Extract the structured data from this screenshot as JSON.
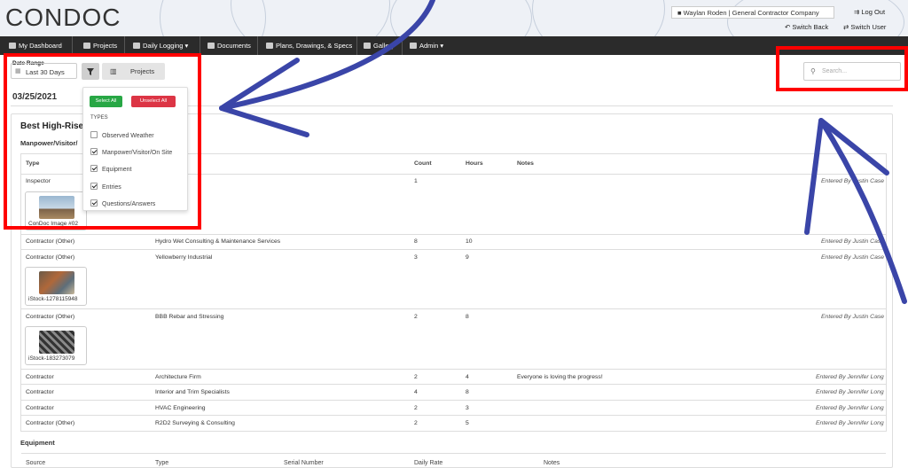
{
  "header": {
    "logo": "CONDOC",
    "user": "Waylan Roden  |  General Contractor Company",
    "logout": "Log Out",
    "switch_back": "Switch Back",
    "switch_user": "Switch User"
  },
  "nav": {
    "items": [
      "My Dashboard",
      "Projects",
      "Daily Logging",
      "Documents",
      "Plans, Drawings, & Specs",
      "Gallery",
      "Admin"
    ],
    "caret": "▾"
  },
  "filters": {
    "date_range_label": "Date Range",
    "date_range_value": "Last 30 Days",
    "projects_label": "Projects",
    "search_placeholder": "Search..."
  },
  "date": "03/25/2021",
  "project_title": "Best High-Rise B",
  "section_manpower": "Manpower/Visitor/",
  "table": {
    "headers": {
      "type": "Type",
      "count": "Count",
      "hours": "Hours",
      "notes": "Notes"
    },
    "rows": [
      {
        "type": "Inspector",
        "company": "",
        "count": "1",
        "hours": "",
        "notes": "",
        "entered": "Entered By Justin Case",
        "image": "ConDoc Image #02"
      },
      {
        "type": "Contractor (Other)",
        "company": "Hydro Wet Consulting & Maintenance Services",
        "count": "8",
        "hours": "10",
        "notes": "",
        "entered": "Entered By Justin Case"
      },
      {
        "type": "Contractor (Other)",
        "company": "Yellowberry Industrial",
        "count": "3",
        "hours": "9",
        "notes": "",
        "entered": "Entered By Justin Case",
        "image": "iStock-1278115948"
      },
      {
        "type": "Contractor (Other)",
        "company": "BBB Rebar and Stressing",
        "count": "2",
        "hours": "8",
        "notes": "",
        "entered": "Entered By Justin Case",
        "image": "iStock-183273079"
      },
      {
        "type": "Contractor",
        "company": "Architecture Firm",
        "count": "2",
        "hours": "4",
        "notes": "Everyone is loving the progress!",
        "entered": "Entered By Jennifer Long"
      },
      {
        "type": "Contractor",
        "company": "Interior and Trim Specialists",
        "count": "4",
        "hours": "8",
        "notes": "",
        "entered": "Entered By Jennifer Long"
      },
      {
        "type": "Contractor",
        "company": "HVAC Engineering",
        "count": "2",
        "hours": "3",
        "notes": "",
        "entered": "Entered By Jennifer Long"
      },
      {
        "type": "Contractor (Other)",
        "company": "R2D2 Surveying & Consulting",
        "count": "2",
        "hours": "5",
        "notes": "",
        "entered": "Entered By Jennifer Long"
      }
    ]
  },
  "section_equipment": "Equipment",
  "equipment_headers": [
    "Source",
    "Type",
    "Serial Number",
    "Daily Rate",
    "Notes"
  ],
  "dropdown": {
    "select_all": "Select All",
    "unselect_all": "Unselect All",
    "types_heading": "TYPES",
    "options": [
      {
        "label": "Observed Weather",
        "checked": false
      },
      {
        "label": "Manpower/Visitor/On Site",
        "checked": true
      },
      {
        "label": "Equipment",
        "checked": true
      },
      {
        "label": "Entries",
        "checked": true
      },
      {
        "label": "Questions/Answers",
        "checked": true
      }
    ]
  },
  "colors": {
    "annotation_red": "#ff0000",
    "arrow_blue": "#3a45a8",
    "select_green": "#28a745",
    "unselect_red": "#dc3545",
    "navbar": "#2b2b2b"
  }
}
